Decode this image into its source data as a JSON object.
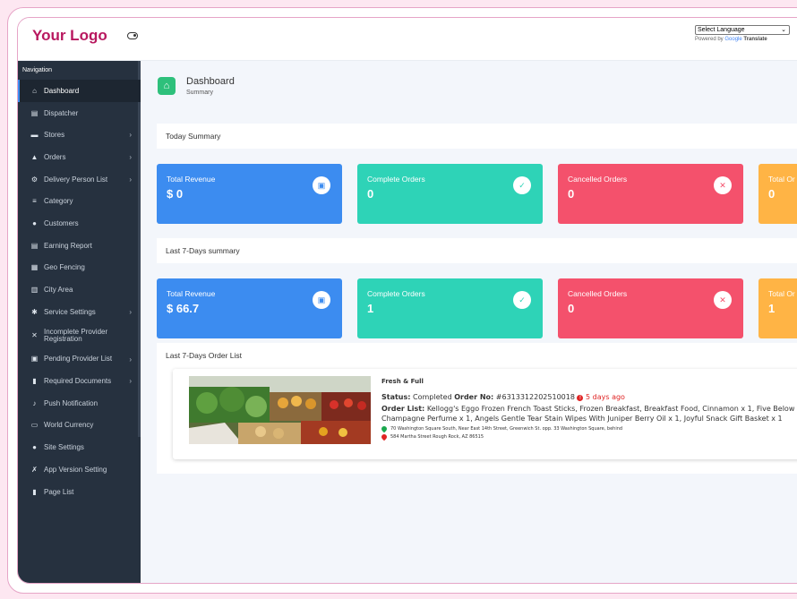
{
  "header": {
    "logo": "Your Logo",
    "language_select": "Select Language",
    "powered_by": "Powered by",
    "google": "Google",
    "translate": "Translate"
  },
  "sidebar": {
    "title": "Navigation",
    "items": [
      {
        "label": "Dashboard",
        "icon": "home-icon",
        "glyph": "⌂",
        "caret": false,
        "active": true
      },
      {
        "label": "Dispatcher",
        "icon": "dispatcher-icon",
        "glyph": "▤",
        "caret": false
      },
      {
        "label": "Stores",
        "icon": "store-icon",
        "glyph": "▬",
        "caret": true
      },
      {
        "label": "Orders",
        "icon": "bag-icon",
        "glyph": "▲",
        "caret": true
      },
      {
        "label": "Delivery Person List",
        "icon": "motorbike-icon",
        "glyph": "⚙",
        "caret": true
      },
      {
        "label": "Category",
        "icon": "list-icon",
        "glyph": "≡",
        "caret": false
      },
      {
        "label": "Customers",
        "icon": "users-icon",
        "glyph": "●",
        "caret": false
      },
      {
        "label": "Earning Report",
        "icon": "report-icon",
        "glyph": "▤",
        "caret": false
      },
      {
        "label": "Geo Fencing",
        "icon": "map-icon",
        "glyph": "▦",
        "caret": false
      },
      {
        "label": "City Area",
        "icon": "city-icon",
        "glyph": "▥",
        "caret": false
      },
      {
        "label": "Service Settings",
        "icon": "gear-icon",
        "glyph": "✱",
        "caret": true
      },
      {
        "label": "Incomplete Provider Registration",
        "icon": "user-slash-icon",
        "glyph": "✕",
        "caret": false
      },
      {
        "label": "Pending Provider List",
        "icon": "id-card-icon",
        "glyph": "▣",
        "caret": true
      },
      {
        "label": "Required Documents",
        "icon": "document-icon",
        "glyph": "▮",
        "caret": true
      },
      {
        "label": "Push Notification",
        "icon": "bell-icon",
        "glyph": "♪",
        "caret": false
      },
      {
        "label": "World Currency",
        "icon": "money-icon",
        "glyph": "▭",
        "caret": false
      },
      {
        "label": "Site Settings",
        "icon": "users-cog-icon",
        "glyph": "●",
        "caret": false
      },
      {
        "label": "App Version Setting",
        "icon": "tools-icon",
        "glyph": "✗",
        "caret": false
      },
      {
        "label": "Page List",
        "icon": "file-icon",
        "glyph": "▮",
        "caret": false
      }
    ]
  },
  "page": {
    "title": "Dashboard",
    "subtitle": "Summary"
  },
  "today": {
    "title": "Today Summary",
    "cards": [
      {
        "label": "Total Revenue",
        "value": "$ 0",
        "icon": "money-bill-icon",
        "glyph": "▣"
      },
      {
        "label": "Complete Orders",
        "value": "0",
        "icon": "clipboard-check-icon",
        "glyph": "✓"
      },
      {
        "label": "Cancelled Orders",
        "value": "0",
        "icon": "cart-x-icon",
        "glyph": "✕"
      },
      {
        "label": "Total Or",
        "value": "0"
      }
    ]
  },
  "week": {
    "title": "Last 7-Days summary",
    "cards": [
      {
        "label": "Total Revenue",
        "value": "$ 66.7",
        "icon": "money-bill-icon",
        "glyph": "▣"
      },
      {
        "label": "Complete Orders",
        "value": "1",
        "icon": "clipboard-check-icon",
        "glyph": "✓"
      },
      {
        "label": "Cancelled Orders",
        "value": "0",
        "icon": "cart-x-icon",
        "glyph": "✕"
      },
      {
        "label": "Total Or",
        "value": "1"
      }
    ]
  },
  "orders": {
    "title": "Last 7-Days Order List",
    "items": [
      {
        "store": "Fresh & Full",
        "status_label": "Status:",
        "status": "Completed",
        "order_no_label": "Order No:",
        "order_no": "#6313312202510018",
        "ago": "5 days ago",
        "list_label": "Order List:",
        "list": "Kellogg's Eggo Frozen French Toast Sticks, Frozen Breakfast, Breakfast Food, Cinnamon x 1, Five Below Very Se Champagne Perfume x 1, Angels Gentle Tear Stain Wipes With Juniper Berry Oil x 1, Joyful Snack Gift Basket x 1",
        "pickup": "70 Washington Square South, Near East 14th Street, Greenwich St. opp. 33 Washington Square, behind",
        "dropoff": "584 Martha Street Rough Rock, AZ 86515"
      }
    ]
  }
}
